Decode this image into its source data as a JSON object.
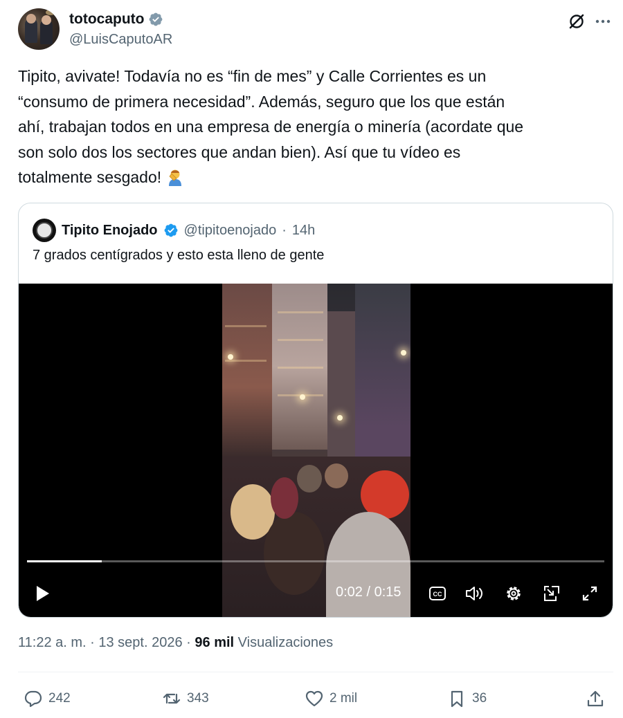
{
  "author": {
    "display_name": "totocaputo",
    "handle": "@LuisCaputoAR"
  },
  "icons": {
    "verified": "verified-badge-icon",
    "grok": "grok-icon",
    "more": "more-options-icon",
    "emoji": "man-facepalming-emoji",
    "reply": "reply-icon",
    "repost": "repost-icon",
    "like": "heart-icon",
    "bookmark": "bookmark-icon",
    "share": "share-icon"
  },
  "tweet": {
    "lines": [
      "Tipito, avivate! Todavía no es “fin de mes” y Calle Corrientes es un",
      "“consumo de primera necesidad”. Además, seguro que los que están",
      "ahí, trabajan todos en una empresa de energía o minería (acordate que",
      "son solo dos los sectores que andan bien). Así que tu vídeo es",
      "totalmente sesgado!"
    ]
  },
  "quote": {
    "display_name": "Tipito Enojado",
    "handle": "@tipitoenojado",
    "separator": "·",
    "time": "14h",
    "text": "7 grados centígrados y esto esta lleno de gente",
    "video": {
      "current_time": "0:02",
      "duration": "0:15",
      "time_label": "0:02 / 0:15",
      "progress_fraction": 0.13
    }
  },
  "meta": {
    "time": "11:22 a. m.",
    "separator": "·",
    "date": "13 sept. 2026",
    "views_count": "96 mil",
    "views_label": "Visualizaciones"
  },
  "actions": {
    "replies": "242",
    "reposts": "343",
    "likes": "2 mil",
    "bookmarks": "36"
  },
  "colors": {
    "text_primary": "#0f1419",
    "text_secondary": "#536471",
    "verified_blue": "#1d9bf0",
    "border": "#cfd9de"
  }
}
